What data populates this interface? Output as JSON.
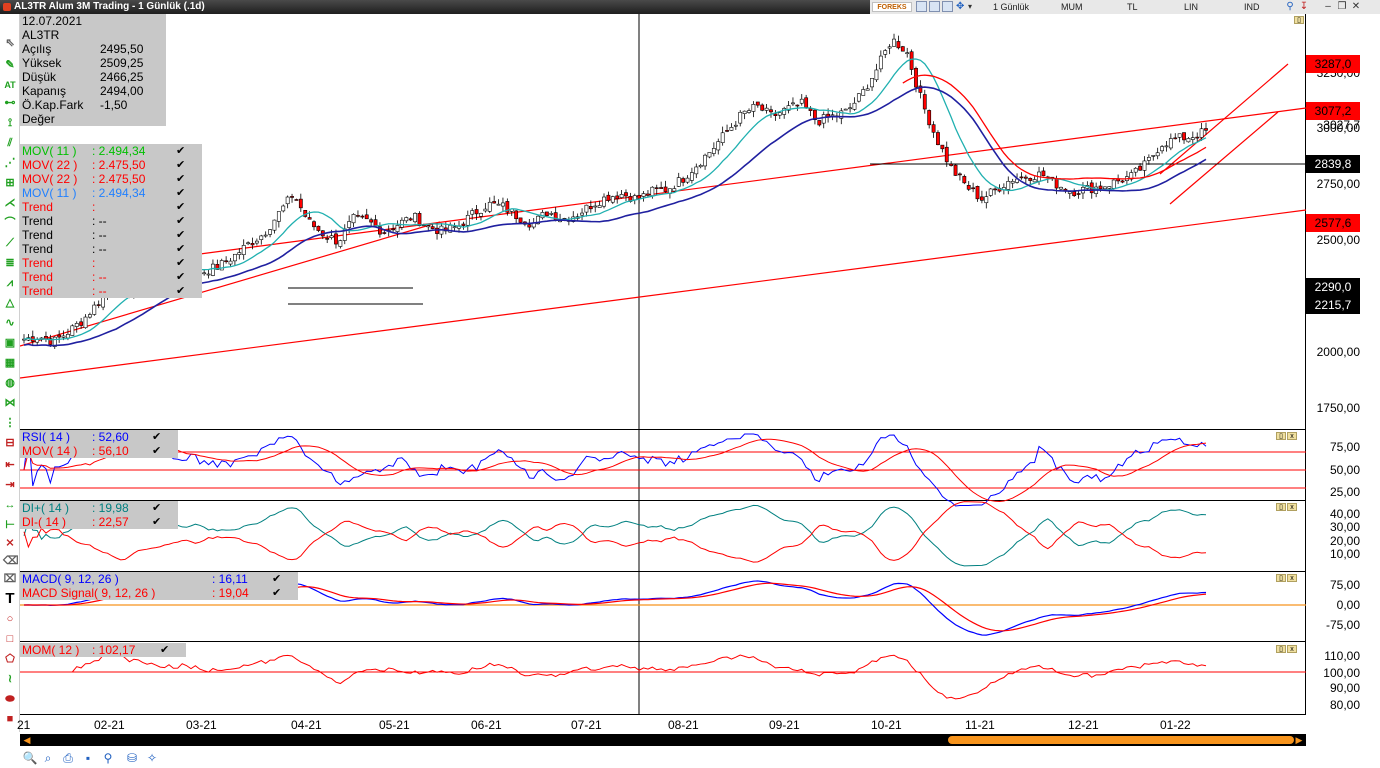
{
  "window": {
    "title": "AL3TR Alum 3M Trading - 1 Günlük (.1d)",
    "brand": "FOREKS",
    "period": "1 Günlük",
    "candle_type": "MUM",
    "currency": "TL",
    "scale": "LIN",
    "index_mode": "IND"
  },
  "info": {
    "date": "12.07.2021",
    "symbol": "AL3TR",
    "rows": [
      {
        "label": "Açılış",
        "value": "2495,50"
      },
      {
        "label": "Yüksek",
        "value": "2509,25"
      },
      {
        "label": "Düşük",
        "value": "2466,25"
      },
      {
        "label": "Kapanış",
        "value": "2494,00"
      },
      {
        "label": "Ö.Kap.Fark",
        "value": "-1,50"
      },
      {
        "label": "Değer",
        "value": ""
      }
    ]
  },
  "price_legend": [
    {
      "name": "MOV( 11 )",
      "value": ": 2.494,34",
      "color": "#00c000"
    },
    {
      "name": "MOV( 22 )",
      "value": ": 2.475,50",
      "color": "#ff0000"
    },
    {
      "name": "MOV( 22 )",
      "value": ": 2.475,50",
      "color": "#ff0000"
    },
    {
      "name": "MOV( 11 )",
      "value": ": 2.494,34",
      "color": "#2080ff"
    },
    {
      "name": "Trend",
      "value": ":",
      "color": "#ff0000"
    },
    {
      "name": "Trend",
      "value": ": --",
      "color": "#000000"
    },
    {
      "name": "Trend",
      "value": ": --",
      "color": "#000000"
    },
    {
      "name": "Trend",
      "value": ": --",
      "color": "#000000"
    },
    {
      "name": "Trend",
      "value": ":",
      "color": "#ff0000"
    },
    {
      "name": "Trend",
      "value": ": --",
      "color": "#ff0000"
    },
    {
      "name": "Trend",
      "value": ": --",
      "color": "#ff0000"
    }
  ],
  "price_axis": [
    "3250,00",
    "3027,7",
    "3000,00",
    "2750,00",
    "2500,00",
    "2000,00",
    "1750,00"
  ],
  "price_tags": [
    {
      "text": "3287,0",
      "style": "red"
    },
    {
      "text": "3077,2",
      "style": "red"
    },
    {
      "text": "2839,8",
      "style": "black"
    },
    {
      "text": "2577,6",
      "style": "red"
    },
    {
      "text": "2290,0",
      "style": "black"
    },
    {
      "text": "2215,7",
      "style": "black"
    }
  ],
  "rsi_legend": [
    {
      "name": "RSI( 14 )",
      "value": ": 52,60",
      "color": "#0000ff"
    },
    {
      "name": "MOV( 14 )",
      "value": ": 56,10",
      "color": "#ff0000"
    }
  ],
  "rsi_axis": [
    "75,00",
    "50,00",
    "25,00"
  ],
  "dmi_legend": [
    {
      "name": "DI+( 14 )",
      "value": ": 19,98",
      "color": "#008080"
    },
    {
      "name": "DI-( 14 )",
      "value": ": 22,57",
      "color": "#ff0000"
    }
  ],
  "dmi_axis": [
    "40,00",
    "30,00",
    "20,00",
    "10,00"
  ],
  "macd_legend": [
    {
      "name": "MACD( 9, 12, 26 )",
      "value": ": 16,11",
      "color": "#0000ff"
    },
    {
      "name": "MACD Signal( 9, 12, 26 )",
      "value": ": 19,04",
      "color": "#ff0000"
    }
  ],
  "macd_axis": [
    "75,00",
    "0,00",
    "-75,00"
  ],
  "mom_legend": [
    {
      "name": "MOM( 12 )",
      "value": ": 102,17",
      "color": "#ff0000"
    }
  ],
  "mom_axis": [
    "110,00",
    "100,00",
    "90,00",
    "80,00"
  ],
  "dates": [
    "21",
    "02-21",
    "03-21",
    "04-21",
    "05-21",
    "06-21",
    "07-21",
    "08-21",
    "09-21",
    "10-21",
    "11-21",
    "12-21",
    "01-22"
  ],
  "colors": {
    "up": "#ffffff",
    "down": "#ff0000",
    "ma_fast": "#20b0b0",
    "ma_slow": "#2020a0",
    "trend": "#ff0000",
    "scroll": "#f7941d"
  },
  "chart_data": {
    "type": "candlestick",
    "symbol": "AL3TR",
    "price_range": [
      1700,
      3300
    ],
    "close_path": [
      2000,
      2010,
      1990,
      2030,
      2080,
      2150,
      2220,
      2200,
      2230,
      2260,
      2280,
      2300,
      2270,
      2290,
      2330,
      2380,
      2420,
      2500,
      2580,
      2470,
      2420,
      2390,
      2480,
      2470,
      2430,
      2460,
      2490,
      2450,
      2430,
      2450,
      2500,
      2540,
      2530,
      2490,
      2460,
      2510,
      2480,
      2500,
      2540,
      2570,
      2580,
      2560,
      2590,
      2600,
      2640,
      2700,
      2760,
      2830,
      2900,
      2930,
      2890,
      2920,
      2940,
      2870,
      2890,
      2910,
      2980,
      3080,
      3200,
      3150,
      2950,
      2800,
      2680,
      2610,
      2560,
      2600,
      2640,
      2650,
      2660,
      2620,
      2590,
      2600,
      2610,
      2630,
      2650,
      2700,
      2780,
      2800,
      2810,
      2830
    ]
  }
}
